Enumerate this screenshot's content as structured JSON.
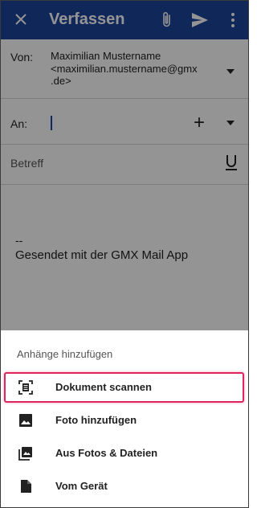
{
  "appbar": {
    "title": "Verfassen",
    "close_icon": "close-icon",
    "attach_icon": "paperclip-icon",
    "send_icon": "send-icon",
    "more_icon": "more-vert-icon",
    "color": "#1c449b"
  },
  "compose": {
    "from_label": "Von:",
    "from_name": "Maximilian Mustername",
    "from_email_line1": "<maximilian.mustername@gmx",
    "from_email_line2": ".de>",
    "to_label": "An:",
    "to_value": "",
    "subject_placeholder": "Betreff",
    "signature_dash": "--",
    "signature_text": "Gesendet mit der GMX Mail App"
  },
  "sheet": {
    "title": "Anhänge hinzufügen",
    "items": [
      {
        "label": "Dokument scannen",
        "icon": "document-scan-icon"
      },
      {
        "label": "Foto hinzufügen",
        "icon": "image-icon"
      },
      {
        "label": "Aus Fotos & Dateien",
        "icon": "photo-library-icon"
      },
      {
        "label": "Vom Gerät",
        "icon": "file-icon"
      }
    ],
    "highlight_color": "#e0245e"
  }
}
